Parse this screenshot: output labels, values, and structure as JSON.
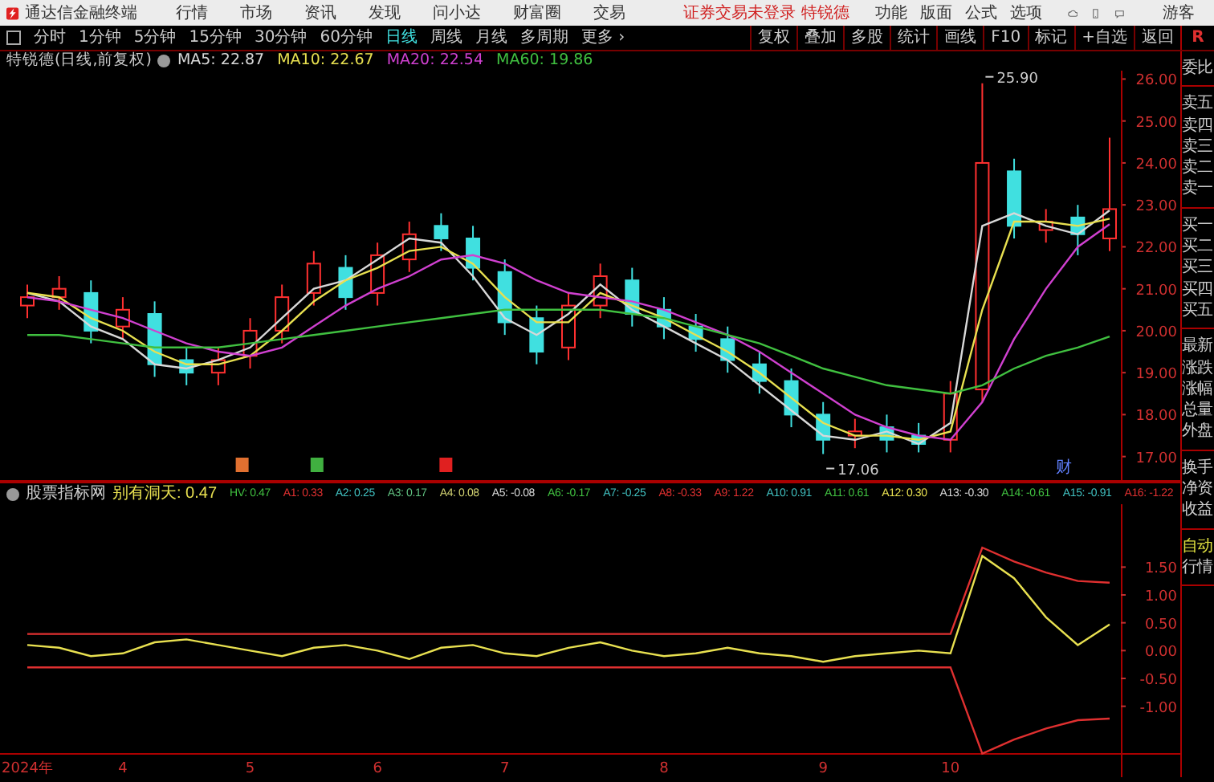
{
  "title_bar": {
    "app_name": "通达信金融终端",
    "menu": [
      "行情",
      "市场",
      "资讯",
      "发现",
      "问小达",
      "财富圈",
      "交易"
    ],
    "notice": "证券交易未登录 特锐德",
    "tools": [
      "功能",
      "版面",
      "公式",
      "选项"
    ],
    "user": "游客"
  },
  "period_tabs": [
    {
      "label": "分时",
      "selected": false
    },
    {
      "label": "1分钟",
      "selected": false
    },
    {
      "label": "5分钟",
      "selected": false
    },
    {
      "label": "15分钟",
      "selected": false
    },
    {
      "label": "30分钟",
      "selected": false
    },
    {
      "label": "60分钟",
      "selected": false
    },
    {
      "label": "日线",
      "selected": true
    },
    {
      "label": "周线",
      "selected": false
    },
    {
      "label": "月线",
      "selected": false
    },
    {
      "label": "多周期",
      "selected": false
    },
    {
      "label": "更多 ›",
      "selected": false
    }
  ],
  "chart_tools": [
    "复权",
    "叠加",
    "多股",
    "统计",
    "画线",
    "F10",
    "标记",
    "+自选",
    "返回"
  ],
  "corner_label": "R",
  "main_chart": {
    "title": "特锐德(日线,前复权)",
    "legend": [
      {
        "text": "MA5: 22.87",
        "color": "#d8d8d8"
      },
      {
        "text": "MA10: 22.67",
        "color": "#e8e050"
      },
      {
        "text": "MA20: 22.54",
        "color": "#d040d0"
      },
      {
        "text": "MA60: 19.86",
        "color": "#40c040"
      }
    ],
    "events": [
      {
        "kind": "icon",
        "color": "#e07030"
      },
      {
        "kind": "icon",
        "color": "#40b040"
      },
      {
        "kind": "icon",
        "color": "#e02020"
      },
      {
        "kind": "text",
        "label": "财",
        "color": "#6080ff"
      }
    ],
    "chart_data": {
      "type": "candlestick",
      "categories": [
        null,
        null,
        null,
        null,
        null,
        null,
        null,
        null,
        null,
        null,
        null,
        null,
        null,
        null,
        null,
        null,
        null,
        null,
        null,
        null,
        null,
        null,
        null,
        null,
        null,
        null,
        null,
        null,
        null,
        null,
        null,
        null,
        null,
        null,
        null
      ],
      "ylim": [
        16.4,
        26.2
      ],
      "ohlc": [
        [
          20.6,
          21.1,
          20.3,
          20.8
        ],
        [
          20.8,
          21.3,
          20.5,
          21.0
        ],
        [
          20.9,
          21.2,
          19.7,
          20.0
        ],
        [
          20.1,
          20.8,
          19.8,
          20.5
        ],
        [
          20.4,
          20.7,
          18.9,
          19.2
        ],
        [
          19.3,
          19.6,
          18.7,
          19.0
        ],
        [
          19.0,
          19.6,
          18.7,
          19.3
        ],
        [
          19.4,
          20.3,
          19.1,
          20.0
        ],
        [
          20.0,
          21.1,
          19.7,
          20.8
        ],
        [
          20.9,
          21.9,
          20.6,
          21.6
        ],
        [
          21.5,
          21.8,
          20.5,
          20.8
        ],
        [
          20.9,
          22.1,
          20.6,
          21.8
        ],
        [
          21.7,
          22.6,
          21.4,
          22.3
        ],
        [
          22.5,
          22.8,
          21.9,
          22.2
        ],
        [
          22.2,
          22.5,
          21.2,
          21.5
        ],
        [
          21.4,
          21.7,
          19.9,
          20.2
        ],
        [
          20.3,
          20.6,
          19.2,
          19.5
        ],
        [
          19.6,
          20.9,
          19.3,
          20.6
        ],
        [
          20.6,
          21.6,
          20.3,
          21.3
        ],
        [
          21.2,
          21.5,
          20.1,
          20.4
        ],
        [
          20.5,
          20.8,
          19.8,
          20.1
        ],
        [
          20.1,
          20.4,
          19.5,
          19.8
        ],
        [
          19.8,
          20.1,
          19.0,
          19.3
        ],
        [
          19.2,
          19.5,
          18.5,
          18.8
        ],
        [
          18.8,
          19.1,
          17.7,
          18.0
        ],
        [
          18.0,
          18.3,
          17.06,
          17.4
        ],
        [
          17.5,
          17.9,
          17.2,
          17.6
        ],
        [
          17.7,
          18.0,
          17.1,
          17.4
        ],
        [
          17.5,
          17.8,
          17.1,
          17.3
        ],
        [
          17.4,
          18.8,
          17.1,
          18.5
        ],
        [
          18.6,
          25.9,
          18.3,
          24.0
        ],
        [
          23.8,
          24.1,
          22.2,
          22.5
        ],
        [
          22.4,
          22.9,
          22.1,
          22.6
        ],
        [
          22.7,
          23.0,
          21.8,
          22.3
        ],
        [
          22.2,
          24.6,
          21.9,
          22.9
        ]
      ],
      "yticks": [
        {
          "value": 17,
          "label": "17.00"
        },
        {
          "value": 18,
          "label": "18.00"
        },
        {
          "value": 19,
          "label": "19.00"
        },
        {
          "value": 20,
          "label": "20.00"
        },
        {
          "value": 21,
          "label": "21.00"
        },
        {
          "value": 22,
          "label": "22.00"
        },
        {
          "value": 23,
          "label": "23.00"
        },
        {
          "value": 24,
          "label": "24.00"
        },
        {
          "value": 25,
          "label": "25.00"
        },
        {
          "value": 26,
          "label": "26.00"
        }
      ],
      "annotations": [
        "25.90",
        "17.06"
      ]
    },
    "ma_lines": {
      "chart_data": {
        "type": "line",
        "categories": [
          null,
          null,
          null,
          null,
          null,
          null,
          null,
          null,
          null,
          null,
          null,
          null,
          null,
          null,
          null,
          null,
          null,
          null,
          null,
          null,
          null,
          null,
          null,
          null,
          null,
          null,
          null,
          null,
          null,
          null,
          null,
          null,
          null,
          null,
          null
        ],
        "ylim": [
          16.4,
          26.2
        ],
        "series": [
          {
            "color": "#d8d8d8",
            "values": [
              20.9,
              20.7,
              20.1,
              19.8,
              19.2,
              19.1,
              19.3,
              19.6,
              20.3,
              21.0,
              21.2,
              21.7,
              22.2,
              22.1,
              21.3,
              20.3,
              19.9,
              20.4,
              21.1,
              20.5,
              20.1,
              19.7,
              19.3,
              18.7,
              18.1,
              17.5,
              17.4,
              17.6,
              17.3,
              17.8,
              22.5,
              22.8,
              22.5,
              22.3,
              22.87
            ]
          },
          {
            "color": "#e8e050",
            "values": [
              20.9,
              20.8,
              20.3,
              20.0,
              19.5,
              19.2,
              19.2,
              19.4,
              20.0,
              20.7,
              21.2,
              21.5,
              21.9,
              22.0,
              21.6,
              20.8,
              20.2,
              20.2,
              20.9,
              20.6,
              20.3,
              19.9,
              19.5,
              19.0,
              18.4,
              17.8,
              17.5,
              17.5,
              17.4,
              17.6,
              20.5,
              22.6,
              22.6,
              22.5,
              22.67
            ]
          },
          {
            "color": "#d040d0",
            "values": [
              20.8,
              20.7,
              20.5,
              20.3,
              20.0,
              19.7,
              19.5,
              19.4,
              19.6,
              20.1,
              20.6,
              21.0,
              21.3,
              21.7,
              21.8,
              21.6,
              21.2,
              20.9,
              20.8,
              20.7,
              20.5,
              20.2,
              19.9,
              19.5,
              19.0,
              18.5,
              18.0,
              17.7,
              17.5,
              17.4,
              18.3,
              19.8,
              21.0,
              22.0,
              22.54
            ]
          },
          {
            "color": "#40c040",
            "values": [
              19.9,
              19.9,
              19.8,
              19.7,
              19.6,
              19.6,
              19.6,
              19.7,
              19.8,
              19.9,
              20.0,
              20.1,
              20.2,
              20.3,
              20.4,
              20.5,
              20.5,
              20.5,
              20.5,
              20.4,
              20.3,
              20.1,
              19.9,
              19.7,
              19.4,
              19.1,
              18.9,
              18.7,
              18.6,
              18.5,
              18.7,
              19.1,
              19.4,
              19.6,
              19.86
            ]
          }
        ]
      }
    }
  },
  "indicator": {
    "name": "股票指标网",
    "legend": [
      {
        "text": "别有洞天: 0.47",
        "color": "#e8e050"
      },
      {
        "text": "HV: 0.47",
        "color": "#40c040"
      },
      {
        "text": "A1: 0.33",
        "color": "#e03030"
      },
      {
        "text": "A2: 0.25",
        "color": "#40c0c0"
      },
      {
        "text": "A3: 0.17",
        "color": "#60c080"
      },
      {
        "text": "A4: 0.08",
        "color": "#d0d070"
      },
      {
        "text": "A5: -0.08",
        "color": "#d8d8d8"
      },
      {
        "text": "A6: -0.17",
        "color": "#40c040"
      },
      {
        "text": "A7: -0.25",
        "color": "#40c0c0"
      },
      {
        "text": "A8: -0.33",
        "color": "#e03030"
      },
      {
        "text": "A9: 1.22",
        "color": "#e03030"
      },
      {
        "text": "A10: 0.91",
        "color": "#40c0c0"
      },
      {
        "text": "A11: 0.61",
        "color": "#40c040"
      },
      {
        "text": "A12: 0.30",
        "color": "#e8e050"
      },
      {
        "text": "A13: -0.30",
        "color": "#d8d8d8"
      },
      {
        "text": "A14: -0.61",
        "color": "#40c040"
      },
      {
        "text": "A15: -0.91",
        "color": "#40c0c0"
      },
      {
        "text": "A16: -1.22",
        "color": "#e03030"
      }
    ],
    "chart_data": {
      "type": "line",
      "categories": [
        "2024年",
        null,
        null,
        "4",
        null,
        null,
        null,
        "5",
        null,
        null,
        null,
        "6",
        null,
        null,
        null,
        "7",
        null,
        null,
        null,
        null,
        "8",
        null,
        null,
        null,
        null,
        "9",
        null,
        null,
        null,
        "10",
        null,
        null,
        null,
        null,
        null
      ],
      "ylim": [
        -1.87,
        2.63
      ],
      "yticks": [
        {
          "value": -1,
          "label": "-1.00"
        },
        {
          "value": -0.5,
          "label": "-0.50"
        },
        {
          "value": 0,
          "label": "0.00"
        },
        {
          "value": 0.5,
          "label": "0.50"
        },
        {
          "value": 1,
          "label": "1.00"
        },
        {
          "value": 1.5,
          "label": "1.50"
        }
      ],
      "series": [
        {
          "color": "#e8e050",
          "values": [
            0.1,
            0.05,
            -0.1,
            -0.05,
            0.15,
            0.2,
            0.1,
            0.0,
            -0.1,
            0.05,
            0.1,
            0.0,
            -0.15,
            0.05,
            0.1,
            -0.05,
            -0.1,
            0.05,
            0.15,
            0.0,
            -0.1,
            -0.05,
            0.05,
            -0.05,
            -0.1,
            -0.2,
            -0.1,
            -0.05,
            0.0,
            -0.05,
            1.7,
            1.3,
            0.6,
            0.1,
            0.47
          ]
        },
        {
          "color": "#e03030",
          "values": [
            0.3,
            0.3,
            0.3,
            0.3,
            0.3,
            0.3,
            0.3,
            0.3,
            0.3,
            0.3,
            0.3,
            0.3,
            0.3,
            0.3,
            0.3,
            0.3,
            0.3,
            0.3,
            0.3,
            0.3,
            0.3,
            0.3,
            0.3,
            0.3,
            0.3,
            0.3,
            0.3,
            0.3,
            0.3,
            0.3,
            1.85,
            1.6,
            1.4,
            1.25,
            1.22
          ]
        },
        {
          "color": "#e03030",
          "values": [
            -0.3,
            -0.3,
            -0.3,
            -0.3,
            -0.3,
            -0.3,
            -0.3,
            -0.3,
            -0.3,
            -0.3,
            -0.3,
            -0.3,
            -0.3,
            -0.3,
            -0.3,
            -0.3,
            -0.3,
            -0.3,
            -0.3,
            -0.3,
            -0.3,
            -0.3,
            -0.3,
            -0.3,
            -0.3,
            -0.3,
            -0.3,
            -0.3,
            -0.3,
            -0.3,
            -1.85,
            -1.6,
            -1.4,
            -1.25,
            -1.22
          ]
        }
      ]
    }
  },
  "side_panel": [
    [
      {
        "text": "委比",
        "active": false
      }
    ],
    [
      {
        "text": "卖五",
        "active": false
      },
      {
        "text": "卖四",
        "active": false
      },
      {
        "text": "卖三",
        "active": false
      },
      {
        "text": "卖二",
        "active": false
      },
      {
        "text": "卖一",
        "active": false
      }
    ],
    [
      {
        "text": "买一",
        "active": false
      },
      {
        "text": "买二",
        "active": false
      },
      {
        "text": "买三",
        "active": false
      },
      {
        "text": "买四",
        "active": false
      },
      {
        "text": "买五",
        "active": false
      }
    ],
    [
      {
        "text": "最新",
        "active": false
      },
      {
        "text": "涨跌",
        "active": false
      },
      {
        "text": "涨幅",
        "active": false
      },
      {
        "text": "总量",
        "active": false
      },
      {
        "text": "外盘",
        "active": false
      }
    ],
    [
      {
        "text": "换手",
        "active": false
      },
      {
        "text": "净资",
        "active": false
      },
      {
        "text": "收益",
        "active": false
      }
    ],
    [
      {
        "text": "自动",
        "active": true
      },
      {
        "text": "行情",
        "active": false
      }
    ]
  ]
}
